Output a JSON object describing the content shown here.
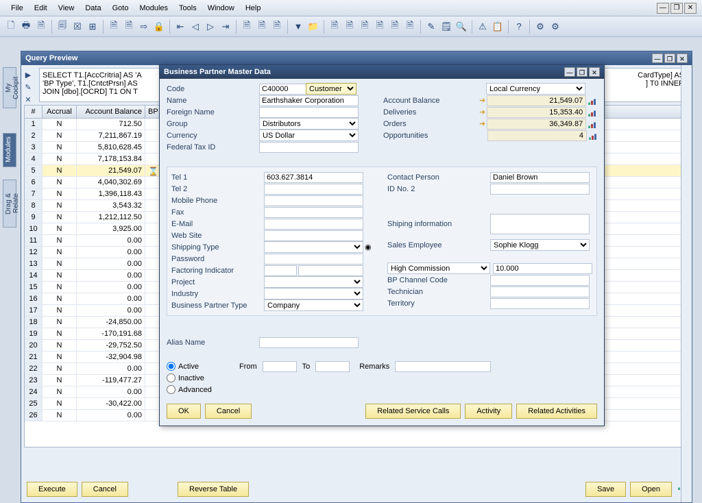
{
  "menubar": {
    "items": [
      "File",
      "Edit",
      "View",
      "Data",
      "Goto",
      "Modules",
      "Tools",
      "Window",
      "Help"
    ]
  },
  "vtabs": {
    "cockpit": "My Cockpit",
    "modules": "Modules",
    "drag": "Drag & Relate"
  },
  "query_window": {
    "title": "Query Preview",
    "sql_line1": "SELECT T1.[AccCritria] AS 'A",
    "sql_line2": "'BP Type', T1.[CntctPrsn] AS",
    "sql_line3": "JOIN [dbo].[OCRD] T1  ON  T",
    "sql_tail1": "CardType] AS",
    "sql_tail2": "] T0 INNER",
    "headers": {
      "num": "#",
      "accrual": "Accrual",
      "balance": "Account Balance",
      "bp": "BP"
    },
    "rows": [
      {
        "n": "1",
        "a": "N",
        "b": "712.50"
      },
      {
        "n": "2",
        "a": "N",
        "b": "7,211,867.19"
      },
      {
        "n": "3",
        "a": "N",
        "b": "5,810,628.45"
      },
      {
        "n": "4",
        "a": "N",
        "b": "7,178,153.84"
      },
      {
        "n": "5",
        "a": "N",
        "b": "21,549.07",
        "sel": true
      },
      {
        "n": "6",
        "a": "N",
        "b": "4,040,302.69"
      },
      {
        "n": "7",
        "a": "N",
        "b": "1,396,118.43"
      },
      {
        "n": "8",
        "a": "N",
        "b": "3,543.32"
      },
      {
        "n": "9",
        "a": "N",
        "b": "1,212,112.50"
      },
      {
        "n": "10",
        "a": "N",
        "b": "3,925.00"
      },
      {
        "n": "11",
        "a": "N",
        "b": "0.00"
      },
      {
        "n": "12",
        "a": "N",
        "b": "0.00"
      },
      {
        "n": "13",
        "a": "N",
        "b": "0.00"
      },
      {
        "n": "14",
        "a": "N",
        "b": "0.00"
      },
      {
        "n": "15",
        "a": "N",
        "b": "0.00"
      },
      {
        "n": "16",
        "a": "N",
        "b": "0.00"
      },
      {
        "n": "17",
        "a": "N",
        "b": "0.00"
      },
      {
        "n": "18",
        "a": "N",
        "b": "-24,850.00"
      },
      {
        "n": "19",
        "a": "N",
        "b": "-170,191.68"
      },
      {
        "n": "20",
        "a": "N",
        "b": "-29,752.50"
      },
      {
        "n": "21",
        "a": "N",
        "b": "-32,904.98"
      },
      {
        "n": "22",
        "a": "N",
        "b": "0.00"
      },
      {
        "n": "23",
        "a": "N",
        "b": "-119,477.27"
      },
      {
        "n": "24",
        "a": "N",
        "b": "0.00"
      },
      {
        "n": "25",
        "a": "N",
        "b": "-30,422.00"
      },
      {
        "n": "26",
        "a": "N",
        "b": "0.00"
      }
    ],
    "buttons": {
      "execute": "Execute",
      "cancel": "Cancel",
      "reverse": "Reverse Table",
      "save": "Save",
      "open": "Open"
    }
  },
  "dialog": {
    "title": "Business Partner Master Data",
    "labels": {
      "code": "Code",
      "name": "Name",
      "foreign": "Foreign Name",
      "group": "Group",
      "currency": "Currency",
      "taxid": "Federal Tax ID",
      "acctbal": "Account Balance",
      "deliveries": "Deliveries",
      "orders": "Orders",
      "opps": "Opportunities",
      "tel1": "Tel 1",
      "tel2": "Tel 2",
      "mobile": "Mobile Phone",
      "fax": "Fax",
      "email": "E-Mail",
      "website": "Web Site",
      "shiptype": "Shipping Type",
      "password": "Password",
      "factoring": "Factoring Indicator",
      "project": "Project",
      "industry": "Industry",
      "bptype": "Business Partner Type",
      "contact": "Contact Person",
      "idno2": "ID No. 2",
      "shipinfo": "Shiping information",
      "salesemp": "Sales Employee",
      "commission": "High Commission",
      "bpchan": "BP Channel Code",
      "tech": "Technician",
      "territory": "Territory",
      "alias": "Alias Name",
      "from": "From",
      "to": "To",
      "remarks": "Remarks"
    },
    "values": {
      "code": "C40000",
      "type": "Customer",
      "name": "Earthshaker Corporation",
      "group": "Distributors",
      "currency": "US Dollar",
      "localcur": "Local Currency",
      "acctbal": "21,549.07",
      "deliveries": "15,353.40",
      "orders": "36,349.87",
      "opps": "4",
      "tel1": "603.627.3814",
      "contact": "Daniel Brown",
      "salesemp": "Sophie Klogg",
      "bptype": "Company",
      "commission": "10.000"
    },
    "status": {
      "active": "Active",
      "inactive": "Inactive",
      "advanced": "Advanced"
    },
    "buttons": {
      "ok": "OK",
      "cancel": "Cancel",
      "related_calls": "Related Service Calls",
      "activity": "Activity",
      "related_act": "Related Activities"
    }
  }
}
